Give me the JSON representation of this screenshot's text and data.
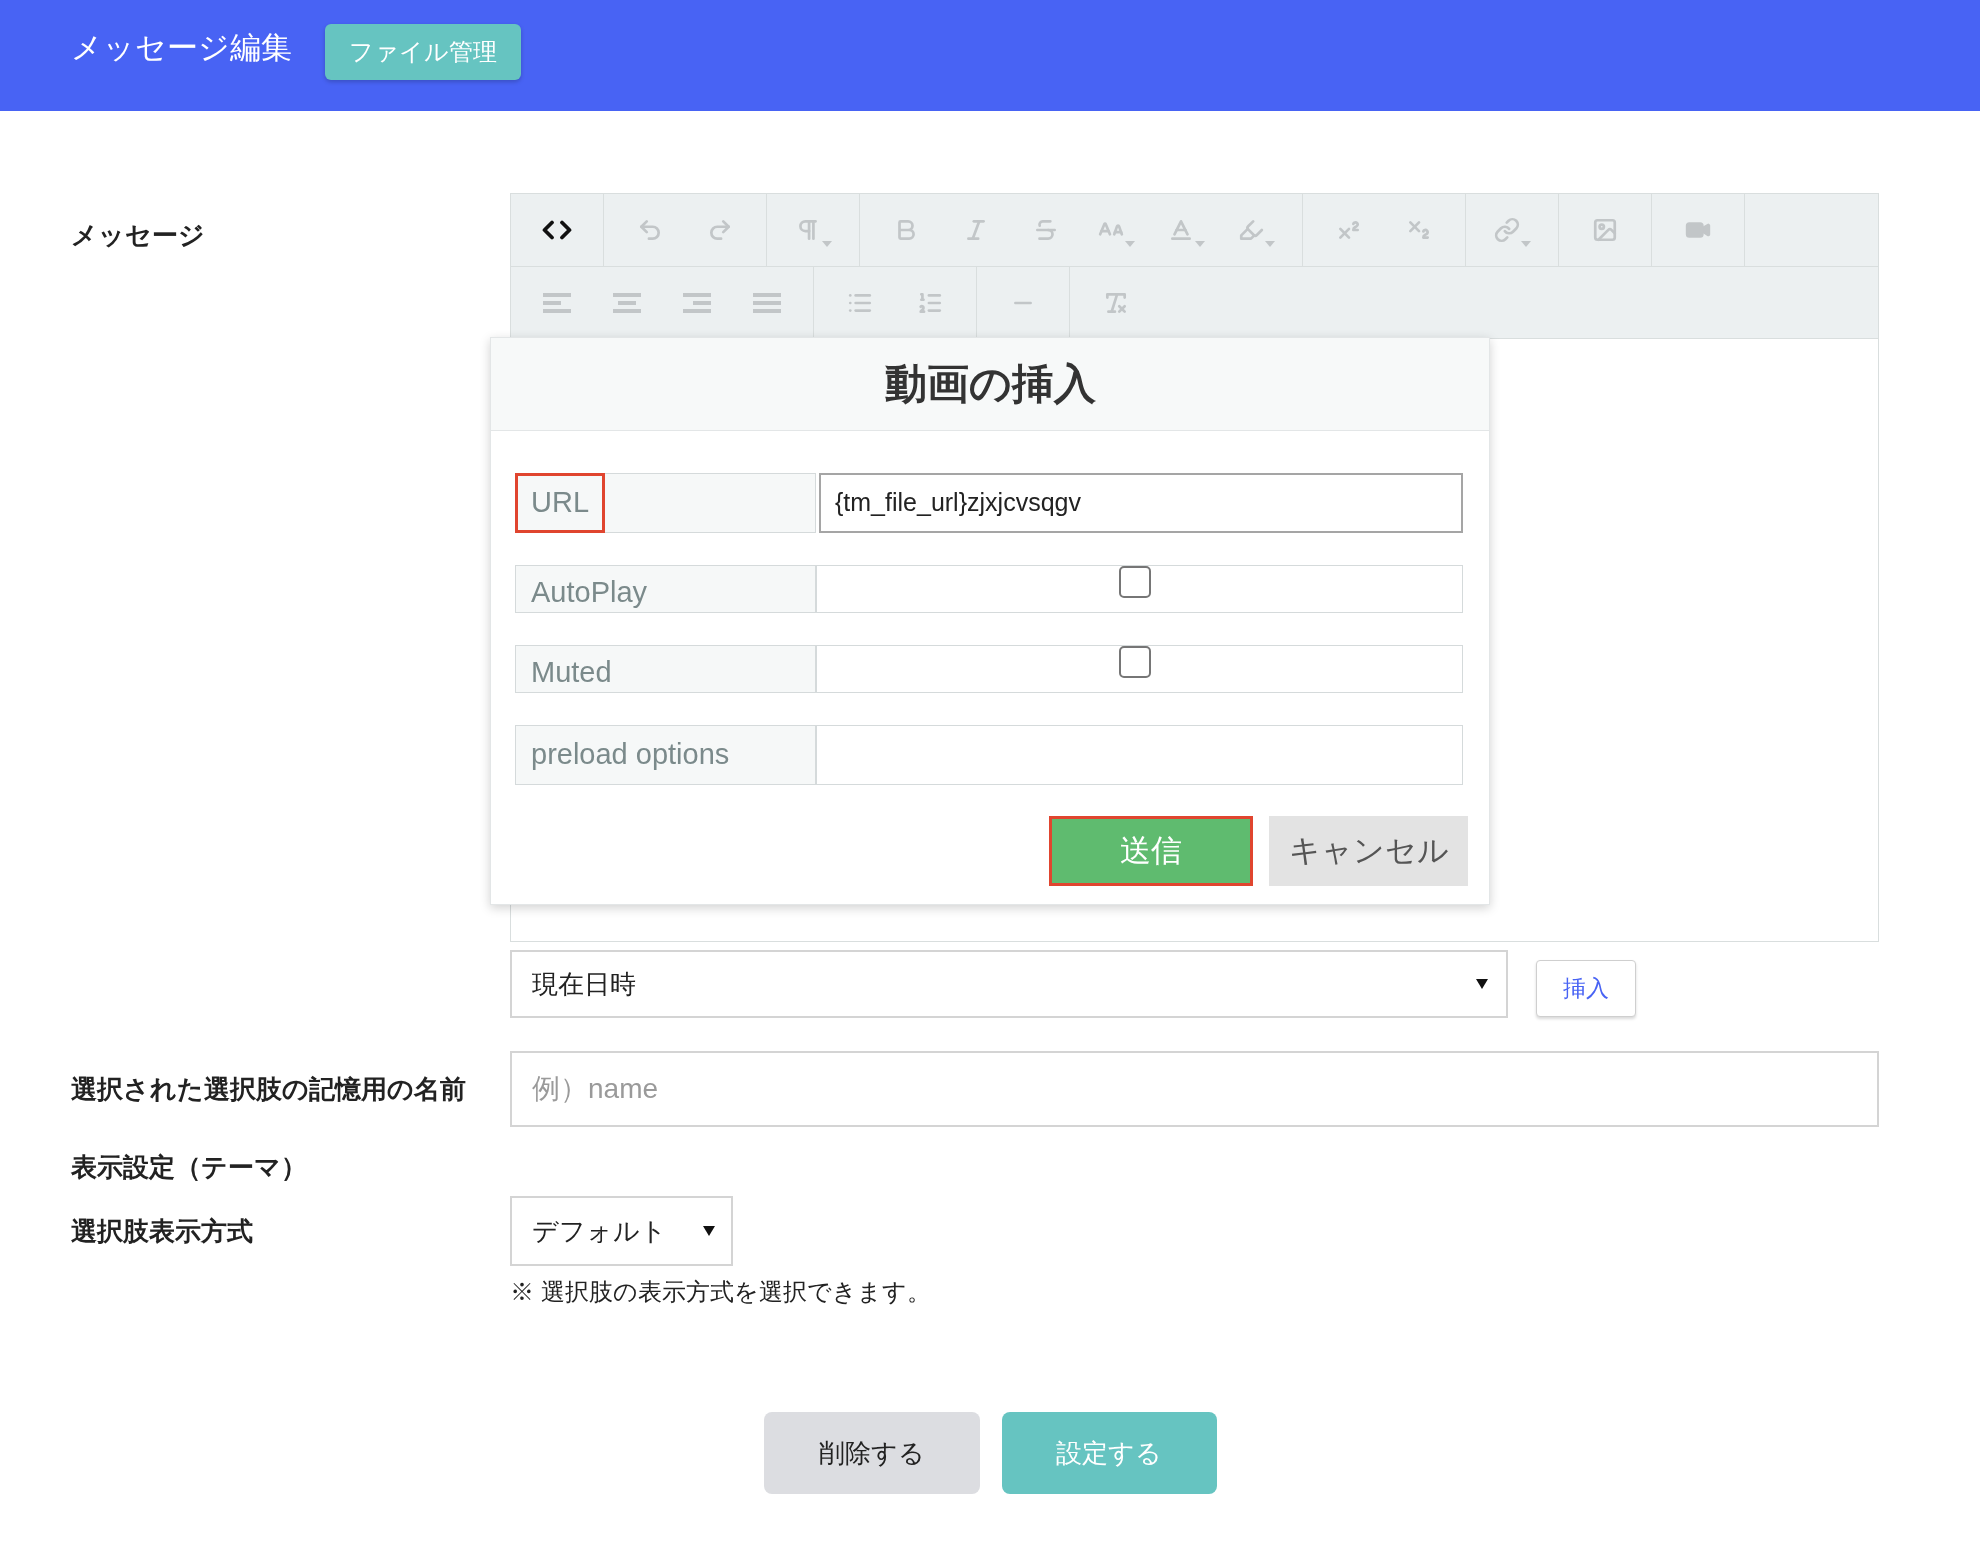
{
  "header": {
    "title": "メッセージ編集",
    "file_button": "ファイル管理"
  },
  "message": {
    "label": "メッセージ",
    "toolbar_rows": [
      [
        [
          {
            "kind": "code",
            "disabled": false,
            "menu": false
          }
        ],
        [
          {
            "kind": "undo",
            "disabled": true,
            "menu": false
          },
          {
            "kind": "redo",
            "disabled": true,
            "menu": false
          }
        ],
        [
          {
            "kind": "paragraph",
            "disabled": true,
            "menu": true
          }
        ],
        [
          {
            "kind": "bold",
            "disabled": true,
            "menu": false
          },
          {
            "kind": "italic",
            "disabled": true,
            "menu": false
          },
          {
            "kind": "strikethrough",
            "disabled": true,
            "menu": false
          },
          {
            "kind": "font_size",
            "disabled": true,
            "menu": true
          },
          {
            "kind": "font_color",
            "disabled": true,
            "menu": true
          },
          {
            "kind": "highlight",
            "disabled": true,
            "menu": true
          }
        ],
        [
          {
            "kind": "superscript",
            "disabled": true,
            "menu": false
          },
          {
            "kind": "subscript",
            "disabled": true,
            "menu": false
          }
        ],
        [
          {
            "kind": "link",
            "disabled": true,
            "menu": true
          }
        ],
        [
          {
            "kind": "image",
            "disabled": true,
            "menu": false
          }
        ],
        [
          {
            "kind": "video",
            "disabled": true,
            "menu": false
          }
        ]
      ],
      [
        [
          {
            "kind": "align_left",
            "disabled": true,
            "menu": false
          },
          {
            "kind": "align_center",
            "disabled": true,
            "menu": false
          },
          {
            "kind": "align_right",
            "disabled": true,
            "menu": false
          },
          {
            "kind": "justify",
            "disabled": true,
            "menu": false
          }
        ],
        [
          {
            "kind": "bullet_list",
            "disabled": true,
            "menu": false
          },
          {
            "kind": "numbered_list",
            "disabled": true,
            "menu": false
          }
        ],
        [
          {
            "kind": "rule",
            "disabled": true,
            "menu": false
          }
        ],
        [
          {
            "kind": "clear_format",
            "disabled": true,
            "menu": false
          }
        ]
      ]
    ]
  },
  "video_dialog": {
    "title": "動画の挿入",
    "fields": [
      {
        "kind": "text",
        "label": "URL",
        "value": "{tm_file_url}zjxjcvsqgv",
        "highlighted": true,
        "focused": true
      },
      {
        "kind": "checkbox",
        "label": "AutoPlay",
        "checked": false,
        "highlighted": false,
        "focused": false
      },
      {
        "kind": "checkbox",
        "label": "Muted",
        "checked": false,
        "highlighted": false,
        "focused": false
      },
      {
        "kind": "text",
        "label": "preload options",
        "highlighted": false,
        "focused": false
      }
    ],
    "buttons": [
      {
        "kind": "primary",
        "label": "送信",
        "highlighted": true
      },
      {
        "kind": "secondary",
        "label": "キャンセル",
        "highlighted": false
      }
    ]
  },
  "tag_select": {
    "value": "現在日時",
    "insert_button": "挿入"
  },
  "name_field": {
    "label": "選択された選択肢の記憶用の名前",
    "placeholder": "例）name"
  },
  "theme_heading": "表示設定（テーマ）",
  "display_mode": {
    "label": "選択肢表示方式",
    "value": "デフォルト",
    "note": "※ 選択肢の表示方式を選択できます。"
  },
  "actions": [
    {
      "kind": "secondary",
      "label": "削除する"
    },
    {
      "kind": "primary",
      "label": "設定する"
    }
  ]
}
